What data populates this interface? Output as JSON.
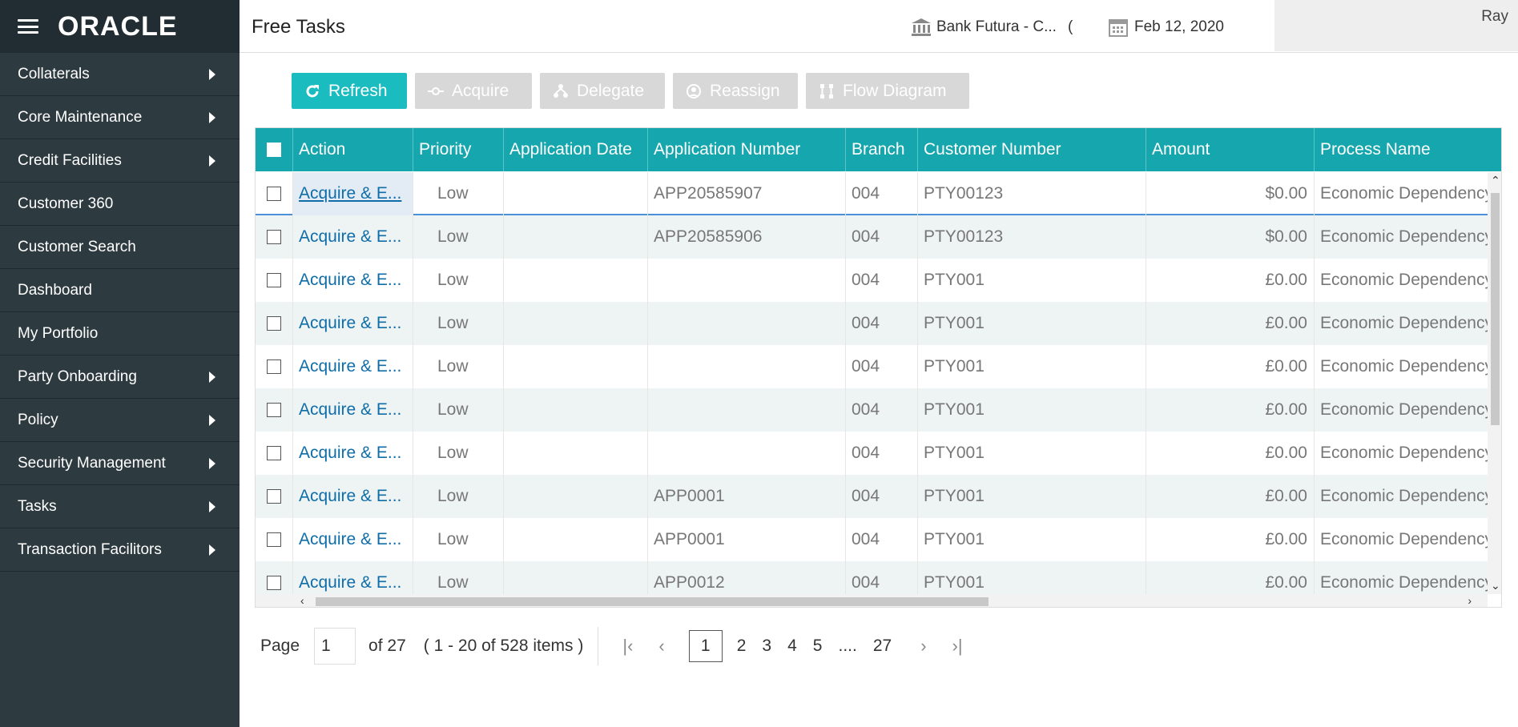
{
  "sidebar": {
    "logo": "ORACLE",
    "items": [
      {
        "label": "Collaterals",
        "has_submenu": true
      },
      {
        "label": "Core Maintenance",
        "has_submenu": true
      },
      {
        "label": "Credit Facilities",
        "has_submenu": true
      },
      {
        "label": "Customer 360",
        "has_submenu": false
      },
      {
        "label": "Customer Search",
        "has_submenu": false
      },
      {
        "label": "Dashboard",
        "has_submenu": false
      },
      {
        "label": "My Portfolio",
        "has_submenu": false
      },
      {
        "label": "Party Onboarding",
        "has_submenu": true
      },
      {
        "label": "Policy",
        "has_submenu": true
      },
      {
        "label": "Security Management",
        "has_submenu": true
      },
      {
        "label": "Tasks",
        "has_submenu": true
      },
      {
        "label": "Transaction Facilitors",
        "has_submenu": true
      }
    ]
  },
  "header": {
    "title": "Free Tasks",
    "bank": "Bank Futura - C...",
    "bank_suffix": "(",
    "date": "Feb 12, 2020",
    "user": "Ray"
  },
  "toolbar": {
    "refresh": "Refresh",
    "acquire": "Acquire",
    "delegate": "Delegate",
    "reassign": "Reassign",
    "flow_diagram": "Flow Diagram"
  },
  "grid": {
    "columns": [
      "Action",
      "Priority",
      "Application Date",
      "Application Number",
      "Branch",
      "Customer Number",
      "Amount",
      "Process Name"
    ],
    "rows": [
      {
        "action": "Acquire & E...",
        "priority": "Low",
        "app_date": "",
        "app_number": "APP20585907",
        "branch": "004",
        "customer": "PTY00123",
        "amount": "$0.00",
        "process": "Economic Dependency"
      },
      {
        "action": "Acquire & E...",
        "priority": "Low",
        "app_date": "",
        "app_number": "APP20585906",
        "branch": "004",
        "customer": "PTY00123",
        "amount": "$0.00",
        "process": "Economic Dependency"
      },
      {
        "action": "Acquire & E...",
        "priority": "Low",
        "app_date": "",
        "app_number": "",
        "branch": "004",
        "customer": "PTY001",
        "amount": "£0.00",
        "process": "Economic Dependency"
      },
      {
        "action": "Acquire & E...",
        "priority": "Low",
        "app_date": "",
        "app_number": "",
        "branch": "004",
        "customer": "PTY001",
        "amount": "£0.00",
        "process": "Economic Dependency"
      },
      {
        "action": "Acquire & E...",
        "priority": "Low",
        "app_date": "",
        "app_number": "",
        "branch": "004",
        "customer": "PTY001",
        "amount": "£0.00",
        "process": "Economic Dependency"
      },
      {
        "action": "Acquire & E...",
        "priority": "Low",
        "app_date": "",
        "app_number": "",
        "branch": "004",
        "customer": "PTY001",
        "amount": "£0.00",
        "process": "Economic Dependency"
      },
      {
        "action": "Acquire & E...",
        "priority": "Low",
        "app_date": "",
        "app_number": "",
        "branch": "004",
        "customer": "PTY001",
        "amount": "£0.00",
        "process": "Economic Dependency"
      },
      {
        "action": "Acquire & E...",
        "priority": "Low",
        "app_date": "",
        "app_number": "APP0001",
        "branch": "004",
        "customer": "PTY001",
        "amount": "£0.00",
        "process": "Economic Dependency"
      },
      {
        "action": "Acquire & E...",
        "priority": "Low",
        "app_date": "",
        "app_number": "APP0001",
        "branch": "004",
        "customer": "PTY001",
        "amount": "£0.00",
        "process": "Economic Dependency"
      },
      {
        "action": "Acquire & E...",
        "priority": "Low",
        "app_date": "",
        "app_number": "APP0012",
        "branch": "004",
        "customer": "PTY001",
        "amount": "£0.00",
        "process": "Economic Dependency"
      }
    ]
  },
  "pager": {
    "page_label": "Page",
    "page_value": "1",
    "of_label": "of 27",
    "items_label": "( 1 - 20 of 528 items )",
    "pages": [
      "1",
      "2",
      "3",
      "4",
      "5",
      "....",
      "27"
    ],
    "current": "1"
  },
  "colors": {
    "sidebar_bg": "#2d3a40",
    "header_teal": "#16a6ad",
    "refresh_button": "#1bbcbf",
    "link": "#0f6da8"
  }
}
